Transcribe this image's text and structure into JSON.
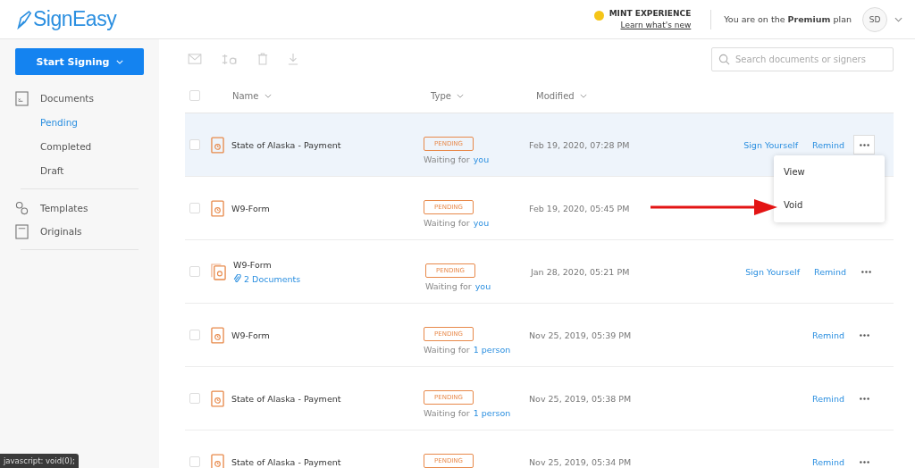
{
  "header": {
    "logo": "SignEasy",
    "promo": {
      "title": "MINT EXPERIENCE",
      "link": "Learn what's new"
    },
    "plan": "You are on the **Premium** plan",
    "avatar": "SD"
  },
  "sidebar": {
    "start_button": "Start Signing",
    "sections": [
      {
        "label": "Documents",
        "kind": "documents",
        "children": [
          {
            "label": "Pending",
            "selected": true
          },
          {
            "label": "Completed",
            "selected": false
          },
          {
            "label": "Draft",
            "selected": false
          }
        ]
      },
      {
        "label": "Templates",
        "kind": "templates"
      },
      {
        "label": "Originals",
        "kind": "originals"
      }
    ]
  },
  "search": {
    "placeholder": "Search documents or signers"
  },
  "table": {
    "select_all": {
      "checked": false
    },
    "columns": [
      "Name",
      "Type",
      "Modified"
    ],
    "rows": [
      {
        "name": "State of Alaska - Payment",
        "kind": "single",
        "checked": false,
        "status": "PENDING",
        "waiting": "Waiting for",
        "waiting_who": "you",
        "modified": "Feb 19, 2020, 07:28 PM",
        "sign_action": "Sign Yourself",
        "remind": "Remind",
        "more_button": true,
        "selected": true
      },
      {
        "name": "W9-Form",
        "kind": "single",
        "checked": false,
        "status": "PENDING",
        "waiting": "Waiting for",
        "waiting_who": "you",
        "modified": "Feb 19, 2020, 05:45 PM",
        "more_button": false,
        "selected": false
      },
      {
        "name": "W9-Form",
        "kind": "multiple",
        "attachments": "2 Documents",
        "checked": false,
        "status": "PENDING",
        "waiting": "Waiting for",
        "waiting_who": "you",
        "modified": "Jan 28, 2020, 05:21 PM",
        "sign_action": "Sign Yourself",
        "remind": "Remind",
        "more_button": true,
        "selected": false
      },
      {
        "name": "W9-Form",
        "kind": "single",
        "checked": false,
        "status": "PENDING",
        "waiting": "Waiting for",
        "waiting_who": "1 person",
        "modified": "Nov 25, 2019, 05:39 PM",
        "remind": "Remind",
        "more_button": true,
        "selected": false
      },
      {
        "name": "State of Alaska - Payment",
        "kind": "single",
        "checked": false,
        "status": "PENDING",
        "waiting": "Waiting for",
        "waiting_who": "1 person",
        "modified": "Nov 25, 2019, 05:38 PM",
        "remind": "Remind",
        "more_button": true,
        "selected": false
      },
      {
        "name": "State of Alaska - Payment",
        "kind": "single",
        "checked": false,
        "status": "PENDING",
        "modified": "Nov 25, 2019, 05:34 PM",
        "remind": "Remind",
        "more_button": true,
        "selected": false
      }
    ]
  },
  "menu": {
    "items": [
      "View",
      "Void"
    ]
  },
  "status_tooltip": "javascript: void(0);"
}
